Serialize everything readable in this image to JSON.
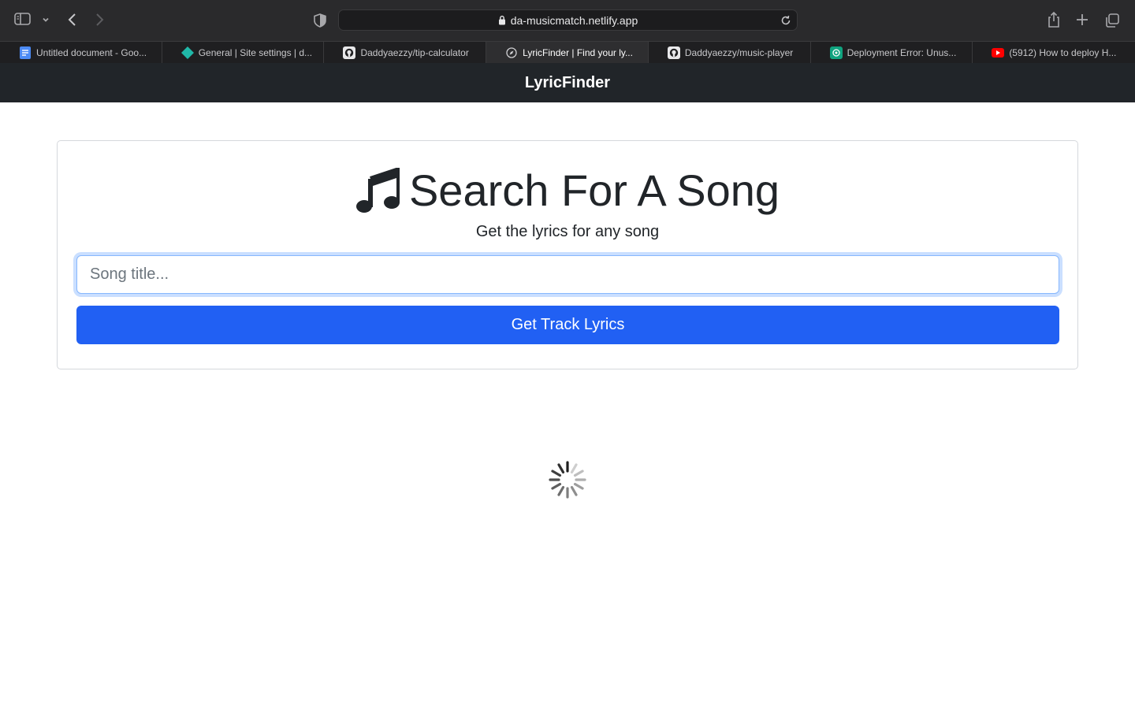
{
  "browser": {
    "url": "da-musicmatch.netlify.app",
    "tabs": [
      {
        "label": "Untitled document - Goo...",
        "icon": "google-docs-icon",
        "active": false
      },
      {
        "label": "General | Site settings | d...",
        "icon": "netlify-icon",
        "active": false
      },
      {
        "label": "Daddyaezzy/tip-calculator",
        "icon": "github-icon",
        "active": false
      },
      {
        "label": "LyricFinder | Find your ly...",
        "icon": "compass-icon",
        "active": true
      },
      {
        "label": "Daddyaezzy/music-player",
        "icon": "github-icon",
        "active": false
      },
      {
        "label": "Deployment Error: Unus...",
        "icon": "openai-icon",
        "active": false
      },
      {
        "label": "(5912) How to deploy H...",
        "icon": "youtube-icon",
        "active": false
      }
    ]
  },
  "navbar": {
    "brand": "LyricFinder"
  },
  "search": {
    "title": "Search For A Song",
    "title_icon": "music-note-icon",
    "subtitle": "Get the lyrics for any song",
    "placeholder": "Song title...",
    "button_label": "Get Track Lyrics"
  },
  "colors": {
    "navbar_bg": "#212529",
    "primary_button": "#2160f3",
    "input_focus": "#86b7fe"
  },
  "loading": {
    "icon": "spinner-icon"
  }
}
